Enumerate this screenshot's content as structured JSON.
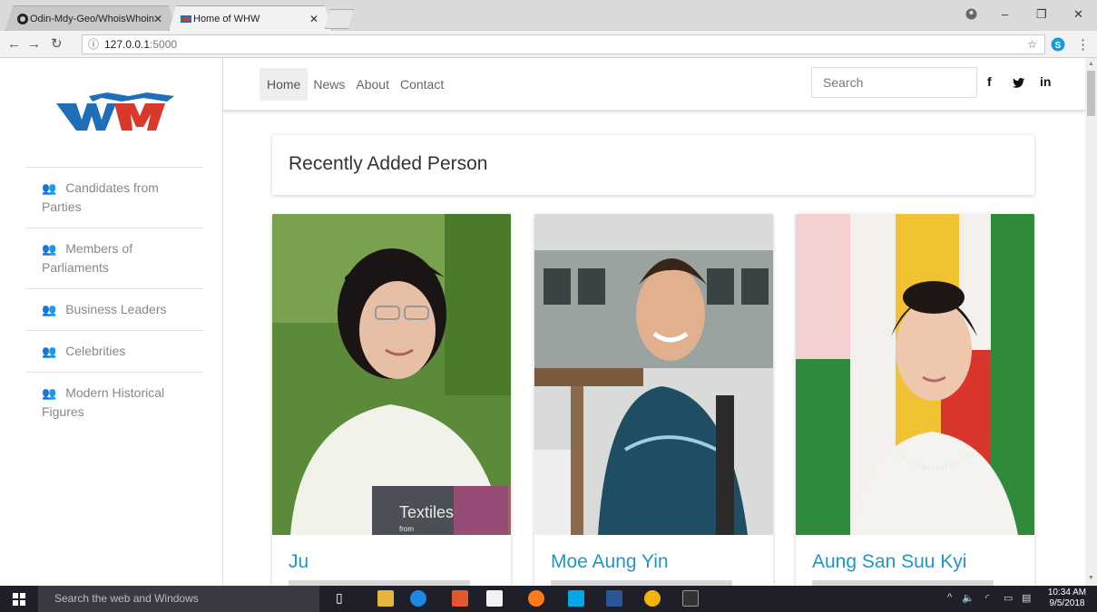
{
  "browser": {
    "tabs": [
      {
        "title": "Odin-Mdy-Geo/WhoisWhoin",
        "active": false
      },
      {
        "title": "Home of WHW",
        "active": true
      }
    ],
    "url_host": "127.0.0.1",
    "url_port": ":5000"
  },
  "site": {
    "logo_text": "WHW",
    "sidebar": {
      "items": [
        {
          "label": "Candidates from Parties"
        },
        {
          "label": "Members of Parliaments"
        },
        {
          "label": "Business Leaders"
        },
        {
          "label": "Celebrities"
        },
        {
          "label": "Modern Historical Figures"
        }
      ]
    },
    "nav": {
      "items": [
        {
          "label": "Home",
          "active": true
        },
        {
          "label": "News"
        },
        {
          "label": "About"
        },
        {
          "label": "Contact"
        }
      ],
      "search_placeholder": "Search",
      "social": [
        "f",
        "t",
        "in"
      ]
    },
    "main": {
      "heading": "Recently Added Person",
      "persons": [
        {
          "name": "Ju",
          "photo_label": "Textiles",
          "photo_label_small": "from"
        },
        {
          "name": "Moe Aung Yin"
        },
        {
          "name": "Aung San Suu Kyi"
        }
      ]
    }
  },
  "taskbar": {
    "search_text": "Search the web and Windows",
    "time": "10:34 AM",
    "date": "9/5/2018"
  },
  "colors": {
    "accent_blue": "#2196c4",
    "sidebar_icon": "#3a79c4",
    "logo_red": "#d9392b",
    "logo_blue": "#1e6fb8"
  }
}
